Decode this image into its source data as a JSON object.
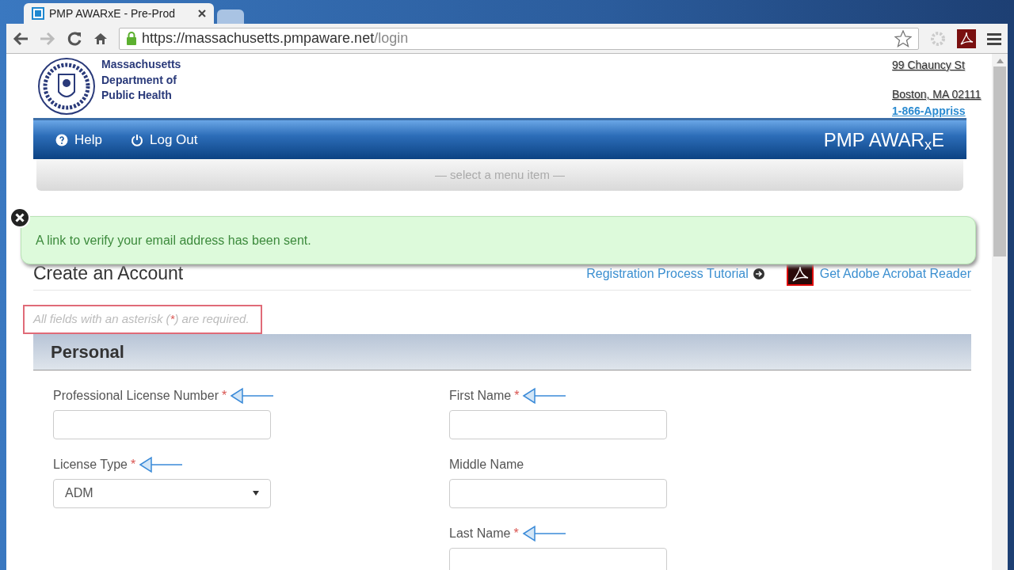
{
  "browser": {
    "tabs": [
      {
        "title": "PMP AWARxE - Pre-Prod",
        "selected": true
      },
      {
        "selected": false
      }
    ],
    "url_host": "https://massachusetts.pmpaware.net",
    "url_path": "/login"
  },
  "header": {
    "org_lines": [
      "Massachusetts",
      "Department of",
      "Public Health"
    ],
    "address": [
      "99 Chauncy St",
      "Boston, MA 02111"
    ],
    "phone": "1-866-Appriss"
  },
  "navbar": {
    "items": [
      {
        "label": "Help"
      },
      {
        "label": "Log Out"
      }
    ],
    "brand": "PMP AWAR$_{x}$E"
  },
  "menu_placeholder": "— select a menu item —",
  "toast": {
    "message": "A link to verify your email address has been sent."
  },
  "page": {
    "subtitle": "Create an Account",
    "tutorial_link": "Registration Process Tutorial",
    "acrobat_link": "Get Adobe Acrobat Reader",
    "required_note": {
      "before": "All fields with an asterisk (",
      "mark": "*",
      "after": ") are required."
    },
    "section": "Personal",
    "columns": [
      [
        {
          "label": "Professional License Number",
          "required": true,
          "annotated": true,
          "kind": "text"
        },
        {
          "label": "License Type",
          "required": true,
          "annotated": true,
          "kind": "select",
          "value": "ADM"
        }
      ],
      [
        {
          "label": "First Name",
          "required": true,
          "annotated": true,
          "kind": "text"
        },
        {
          "label": "Middle Name",
          "required": false,
          "annotated": false,
          "kind": "text"
        },
        {
          "label": "Last Name",
          "required": true,
          "annotated": true,
          "kind": "text"
        }
      ]
    ]
  }
}
